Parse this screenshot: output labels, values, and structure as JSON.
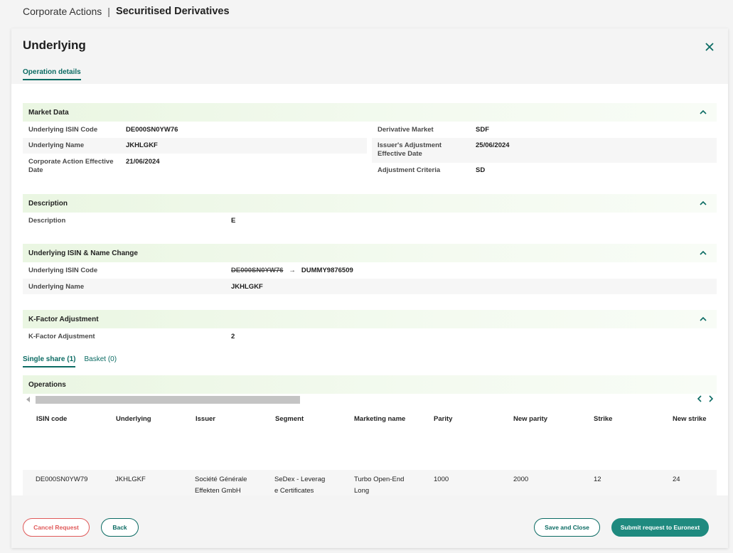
{
  "breadcrumb": {
    "parent": "Corporate Actions",
    "separator": "|",
    "current": "Securitised Derivatives"
  },
  "modal": {
    "title": "Underlying",
    "tab": "Operation details"
  },
  "market_data": {
    "title": "Market Data",
    "left": [
      {
        "label": "Underlying ISIN Code",
        "value": "DE000SN0YW76"
      },
      {
        "label": "Underlying Name",
        "value": "JKHLGKF"
      },
      {
        "label": "Corporate Action Effective Date",
        "value": "21/06/2024"
      }
    ],
    "right": [
      {
        "label": "Derivative Market",
        "value": "SDF"
      },
      {
        "label": "Issuer's Adjustment Effective Date",
        "value": "25/06/2024"
      },
      {
        "label": "Adjustment Criteria",
        "value": "SD"
      }
    ]
  },
  "description": {
    "title": "Description",
    "label": "Description",
    "value": "E"
  },
  "isin_change": {
    "title": "Underlying ISIN & Name Change",
    "isin_label": "Underlying ISIN Code",
    "isin_old": "DE000SN0YW76",
    "arrow": "→",
    "isin_new": "DUMMY9876509",
    "name_label": "Underlying Name",
    "name_value": "JKHLGKF"
  },
  "kfactor": {
    "title": "K-Factor Adjustment",
    "label": "K-Factor Adjustment",
    "value": "2"
  },
  "subtabs": {
    "single": "Single share (1)",
    "basket": "Basket (0)"
  },
  "operations": {
    "title": "Operations",
    "columns": [
      "ISIN code",
      "Underlying",
      "Issuer",
      "Segment",
      "Marketing name",
      "Parity",
      "New parity",
      "Strike",
      "New strike"
    ],
    "row": {
      "isin": "DE000SN0YW79",
      "underlying": "JKHLGKF",
      "issuer_1": "Société Générale",
      "issuer_2": "Effekten GmbH",
      "segment_1": "SeDex - Leverag",
      "segment_2": "e Certificates",
      "marketing_1": "Turbo Open-End",
      "marketing_2": "Long",
      "parity": "1000",
      "new_parity": "2000",
      "strike": "12",
      "new_strike": "24"
    }
  },
  "footer": {
    "cancel": "Cancel Request",
    "back": "Back",
    "save": "Save and Close",
    "submit": "Submit request to Euronext"
  },
  "colors": {
    "accent": "#0b6b63",
    "danger": "#e05a5a",
    "submit": "#1f8a7f"
  },
  "icons": {
    "close": "close-icon",
    "chevron": "chevron-up-icon",
    "arrow": "arrow-right-icon"
  }
}
